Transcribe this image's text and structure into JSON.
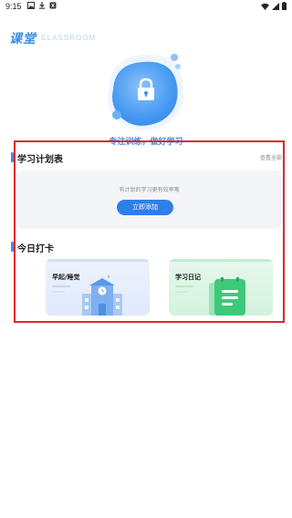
{
  "status_bar": {
    "time": "9:15",
    "left_icons": [
      "image-icon",
      "download-icon",
      "app-icon"
    ],
    "right_icons": [
      "wifi-icon",
      "signal-icon",
      "battery-icon"
    ]
  },
  "header": {
    "title": "课堂",
    "subtitle": "CLASSROOM"
  },
  "hero": {
    "icon": "lock-icon",
    "slogan": "专注训练，做好学习"
  },
  "plan_section": {
    "title": "学习计划表",
    "view_all": "查看全部",
    "hint": "有计划的学习更有效率哦",
    "add_button": "立即添加"
  },
  "checkin_section": {
    "title": "今日打卡",
    "cards": [
      {
        "label": "早起/睡觉",
        "icon": "school-building-icon"
      },
      {
        "label": "学习日记",
        "icon": "notebook-icon"
      }
    ]
  },
  "colors": {
    "accent": "#3e8de6",
    "button": "#2f7fe8",
    "highlight": "#e0262b"
  }
}
